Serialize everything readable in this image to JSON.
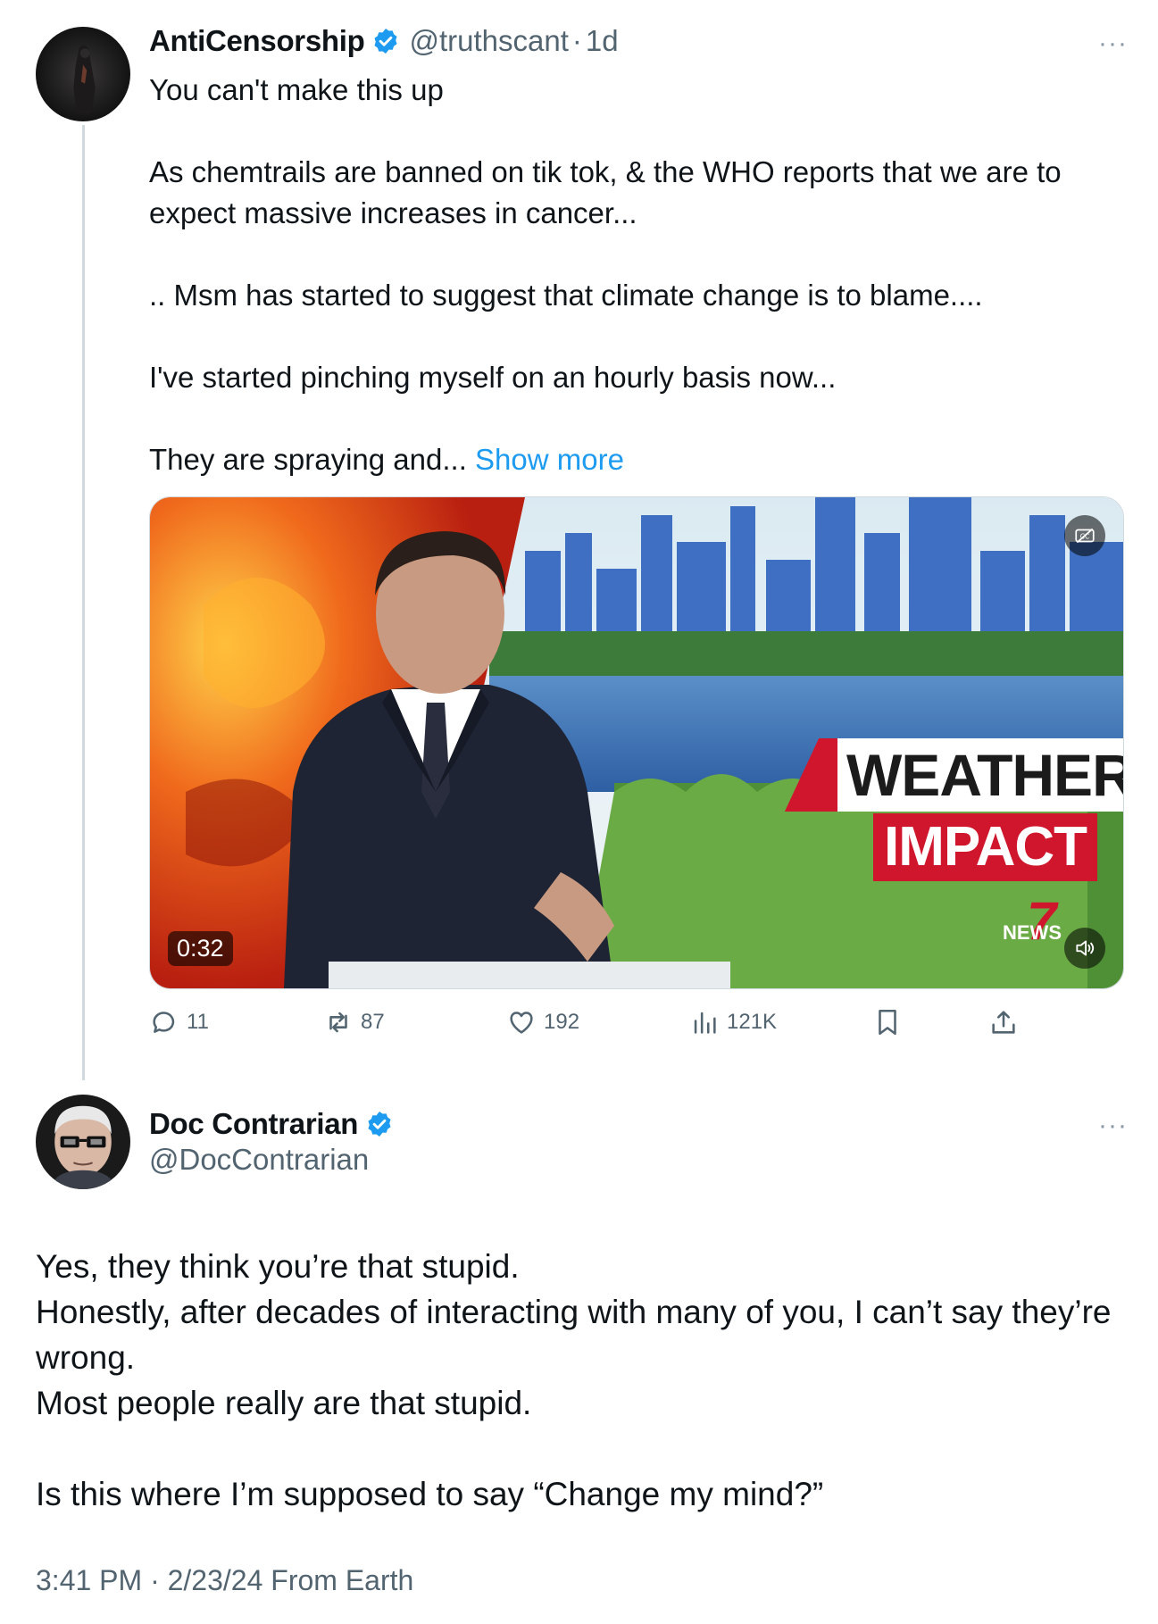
{
  "post1": {
    "display_name": "AntiCensorship",
    "handle": "@truthscant",
    "separator": "·",
    "age": "1d",
    "more_label": "···",
    "avatar_icon": "dark-figure-avatar",
    "verified_icon": "verified-badge-icon",
    "paragraphs": [
      "You can't make this up",
      "As chemtrails are banned on tik tok, & the WHO reports that we are to expect massive increases in cancer...",
      ".. Msm has started to suggest that climate change is to blame....",
      "I've started pinching myself on an hourly basis now...",
      "They are spraying and..."
    ],
    "show_more": "Show more",
    "video": {
      "duration": "0:32",
      "banner_line1": "WEATHER",
      "banner_line2": "IMPACT",
      "logo_number": "7",
      "logo_text": "NEWS",
      "cc_icon": "captions-off-icon",
      "volume_icon": "volume-icon"
    },
    "actions": {
      "replies": "11",
      "reposts": "87",
      "likes": "192",
      "views": "121K"
    }
  },
  "post2": {
    "display_name": "Doc Contrarian",
    "handle": "@DocContrarian",
    "more_label": "···",
    "avatar_icon": "elderly-man-glasses-avatar",
    "lines": [
      "Yes, they think you’re that stupid.",
      "Honestly, after decades of interacting with many of you, I can’t say they’re wrong.",
      "Most people really are that stupid."
    ],
    "closing_line": "Is this where I’m supposed to say “Change my mind?”",
    "timestamp": "3:41 PM · 2/23/24 From Earth"
  },
  "colors": {
    "accent": "#1d9bf0",
    "secondary_text": "#536471",
    "thread_line": "#cfd9de",
    "brand_red": "#d0162c"
  }
}
